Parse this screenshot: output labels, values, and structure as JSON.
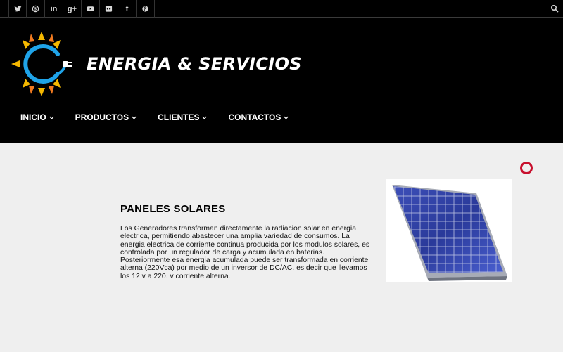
{
  "social_links": [
    {
      "icon": "twitter-icon"
    },
    {
      "icon": "skype-icon"
    },
    {
      "icon": "linkedin-icon",
      "glyph": "in"
    },
    {
      "icon": "google-plus-icon",
      "glyph": "g+"
    },
    {
      "icon": "youtube-icon"
    },
    {
      "icon": "flickr-icon"
    },
    {
      "icon": "facebook-icon",
      "glyph": "f"
    },
    {
      "icon": "pinterest-icon"
    }
  ],
  "header": {
    "brand_name": "ENERGIA & SERVICIOS"
  },
  "nav": {
    "items": [
      {
        "label": "INICIO"
      },
      {
        "label": "PRODUCTOS"
      },
      {
        "label": "CLIENTES"
      },
      {
        "label": "CONTACTOS"
      }
    ]
  },
  "content": {
    "title": "PANELES SOLARES",
    "paragraph1": "Los Generadores transforman directamente la radiacion solar en energia electrica, permitiendo abastecer una amplia variedad de consumos. La energia electrica de corriente continua producida por los modulos solares, es controlada por un regulador de carga y acumulada en baterias.",
    "paragraph2": "Posteriormente esa energia acumulada puede ser transformada en corriente alterna (220Vca) por medio de un inversor de DC/AC, es decir que llevamos los 12 v a 220. v corriente alterna."
  },
  "colors": {
    "background": "#efefef",
    "header_bg": "#000000",
    "accent_ring": "#c8102e",
    "logo_blue": "#1fa3e8",
    "logo_sun": "#f5b800"
  }
}
